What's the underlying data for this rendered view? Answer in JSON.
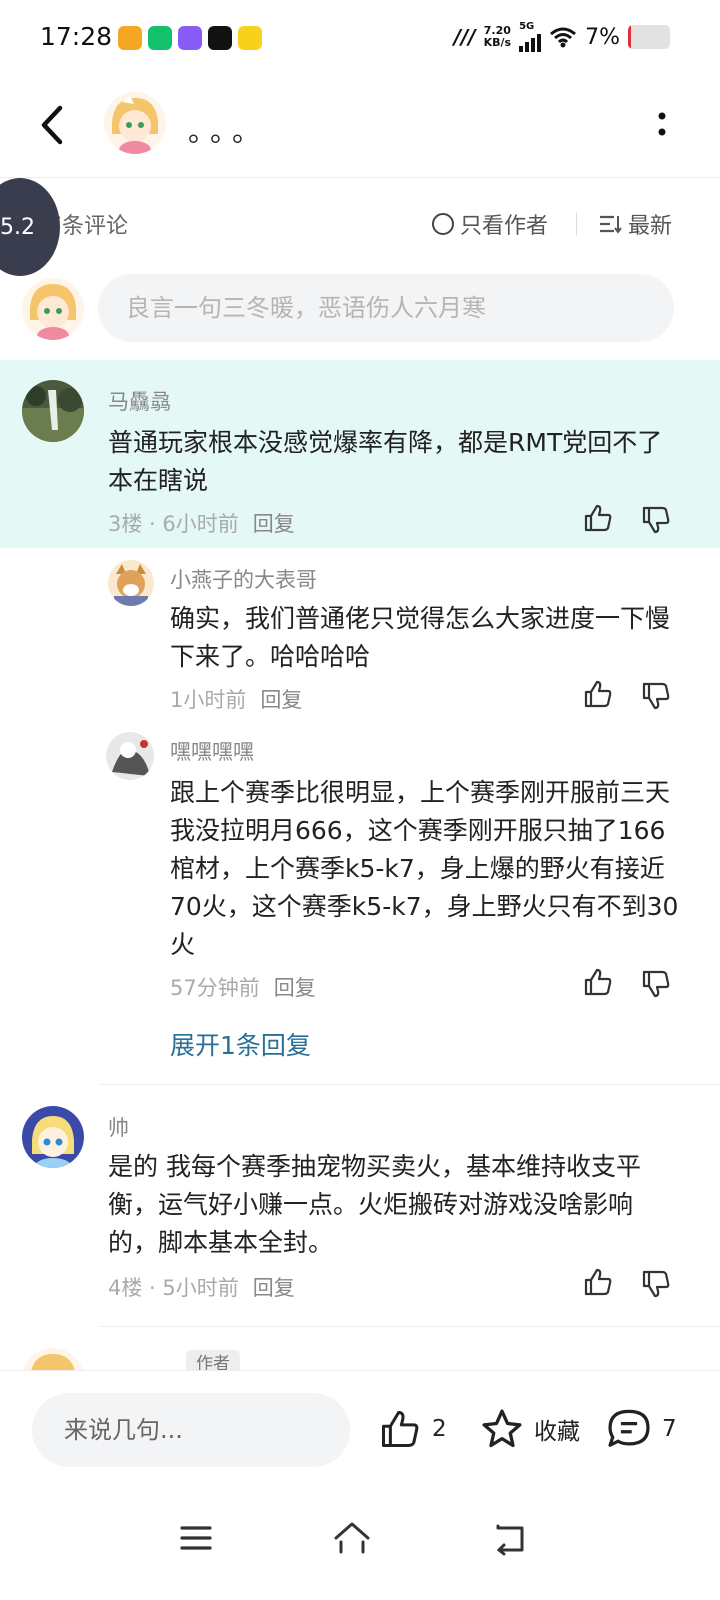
{
  "status_bar": {
    "time": "17:28",
    "net_speed_value": "7.20",
    "net_speed_unit": "KB/s",
    "network": "5G",
    "battery": "7%",
    "battery_level": 0.07,
    "app_icon_colors": [
      "#f5a623",
      "#12c16b",
      "#8a5cf6",
      "#111111",
      "#f7d21c"
    ]
  },
  "header": {
    "title": "。。。",
    "back_icon": "chevron-left-icon",
    "more_icon": "more-vertical-icon"
  },
  "comments_header": {
    "count_label": "共7条评论",
    "only_author_label": "只看作者",
    "sort_label": "最新",
    "floating_badge": "5.2"
  },
  "comment_input": {
    "placeholder": "良言一句三冬暖，恶语伤人六月寒"
  },
  "comments": [
    {
      "name": "马驫骉",
      "text": "普通玩家根本没感觉爆率有降，都是RMT党回不了本在瞎说",
      "floor_time": "3楼 · 6小时前",
      "reply_label": "回复",
      "highlighted": true,
      "replies": [
        {
          "name": "小燕子的大表哥",
          "text": "确实，我们普通佬只觉得怎么大家进度一下慢下来了。哈哈哈哈",
          "time": "1小时前",
          "reply_label": "回复"
        },
        {
          "name": "嘿嘿嘿嘿",
          "text": "跟上个赛季比很明显，上个赛季刚开服前三天我没拉明月666，这个赛季刚开服只抽了166棺材，上个赛季k5-k7，身上爆的野火有接近70火，这个赛季k5-k7，身上野火只有不到30火",
          "time": "57分钟前",
          "reply_label": "回复"
        }
      ],
      "expand_label": "展开1条回复"
    },
    {
      "name": "帅",
      "text": "是的 我每个赛季抽宠物买卖火，基本维持收支平衡，运气好小赚一点。火炬搬砖对游戏没啥影响的，脚本基本全封。",
      "floor_time": "4楼 · 5小时前",
      "reply_label": "回复",
      "highlighted": false
    },
    {
      "name": "。。。",
      "author_tag": "作者"
    }
  ],
  "bottom_bar": {
    "say_placeholder": "来说几句...",
    "like_count": "2",
    "favorite_label": "收藏",
    "comment_count": "7"
  },
  "colors": {
    "highlight_bg": "#e4f8f6",
    "link": "#2a6f98",
    "input_bg": "#f3f4f6"
  }
}
